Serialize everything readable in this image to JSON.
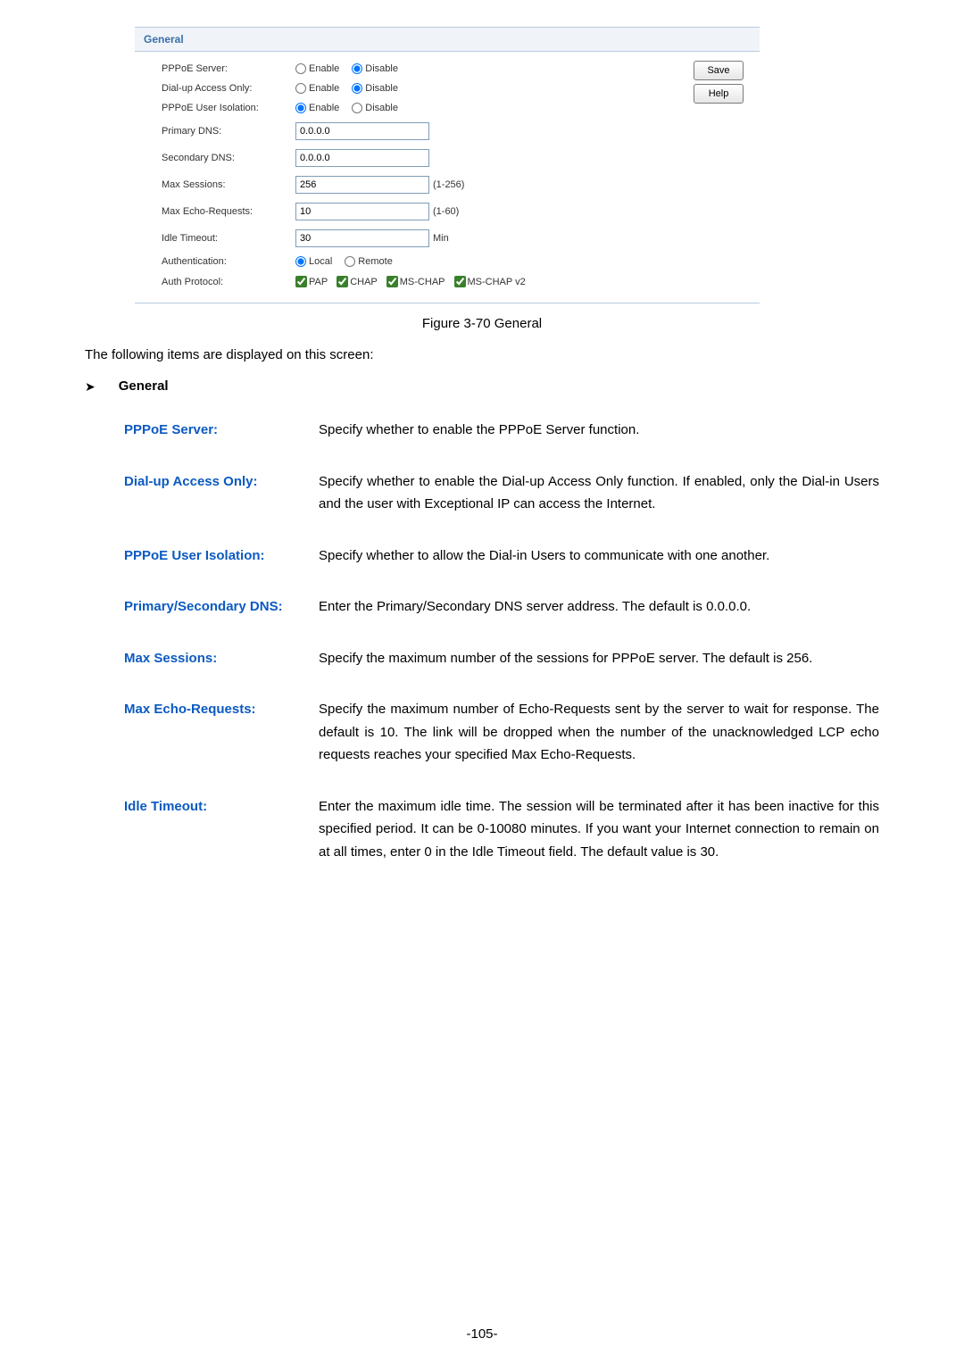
{
  "panel": {
    "title": "General",
    "save": "Save",
    "help": "Help",
    "rows": {
      "pppoe_server": {
        "label": "PPPoE Server:",
        "opt1": "Enable",
        "opt2": "Disable"
      },
      "dialup": {
        "label": "Dial-up Access Only:",
        "opt1": "Enable",
        "opt2": "Disable"
      },
      "isolation": {
        "label": "PPPoE User Isolation:",
        "opt1": "Enable",
        "opt2": "Disable"
      },
      "pdns": {
        "label": "Primary DNS:",
        "value": "0.0.0.0"
      },
      "sdns": {
        "label": "Secondary DNS:",
        "value": "0.0.0.0"
      },
      "max_sessions": {
        "label": "Max Sessions:",
        "value": "256",
        "suffix": "(1-256)"
      },
      "max_echo": {
        "label": "Max Echo-Requests:",
        "value": "10",
        "suffix": "(1-60)"
      },
      "idle": {
        "label": "Idle Timeout:",
        "value": "30",
        "suffix": "Min"
      },
      "auth": {
        "label": "Authentication:",
        "opt1": "Local",
        "opt2": "Remote"
      },
      "proto": {
        "label": "Auth Protocol:",
        "c1": "PAP",
        "c2": "CHAP",
        "c3": "MS-CHAP",
        "c4": "MS-CHAP v2"
      }
    }
  },
  "figure_caption": "Figure 3-70 General",
  "intro": "The following items are displayed on this screen:",
  "section_title": "General",
  "defs": {
    "pppoe_server": {
      "term": "PPPoE Server:",
      "desc": "Specify whether to enable the PPPoE Server function."
    },
    "dialup": {
      "term": "Dial-up Access Only:",
      "desc": "Specify whether to enable the Dial-up Access Only function. If enabled, only the Dial-in Users and the user with Exceptional IP can access the Internet."
    },
    "isolation": {
      "term": "PPPoE User Isolation:",
      "desc": "Specify whether to allow the Dial-in Users to communicate with one another."
    },
    "dns": {
      "term": "Primary/Secondary DNS:",
      "desc": "Enter the Primary/Secondary DNS server address. The default is 0.0.0.0."
    },
    "max_sessions": {
      "term": "Max Sessions:",
      "desc": "Specify the maximum number of the sessions for PPPoE server. The default is 256."
    },
    "max_echo": {
      "term": "Max Echo-Requests:",
      "desc": "Specify the maximum number of Echo-Requests sent by the server to wait for response. The default is 10. The link will be dropped when the number of the unacknowledged LCP echo requests reaches your specified Max Echo-Requests."
    },
    "idle": {
      "term": "Idle Timeout:",
      "desc": "Enter the maximum idle time. The session will be terminated after it has been inactive for this specified period. It can be 0-10080 minutes. If you want your Internet connection to remain on at all times, enter 0 in the Idle Timeout field. The default value is 30."
    }
  },
  "page_num": "-105-"
}
